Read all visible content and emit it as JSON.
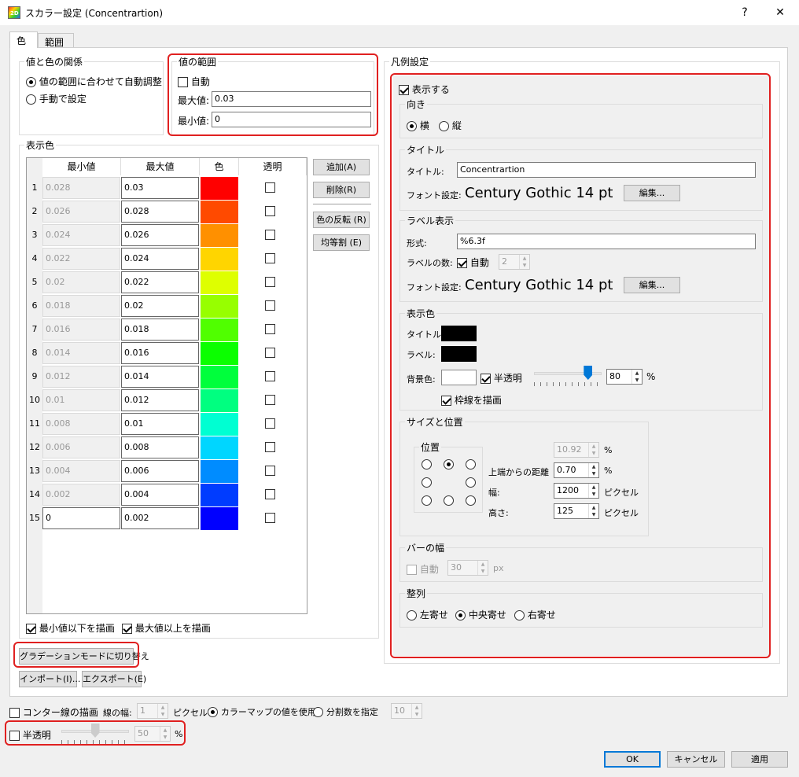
{
  "window": {
    "title": "スカラー設定 (Concentrartion)",
    "help": "?",
    "close": "✕",
    "app_icon": "app-2d-icon"
  },
  "tabs": [
    "色",
    "範囲"
  ],
  "relation": {
    "legend": "値と色の関係",
    "opt_auto": "値の範囲に合わせて自動調整",
    "opt_manual": "手動で設定"
  },
  "range": {
    "legend": "値の範囲",
    "auto_label": "自動",
    "max_label": "最大値:",
    "max_value": "0.03",
    "min_label": "最小値:",
    "min_value": "0"
  },
  "display_colors": {
    "legend": "表示色",
    "headers": [
      "最小値",
      "最大値",
      "色",
      "透明"
    ],
    "rows": [
      {
        "n": "1",
        "min": "0.028",
        "max": "0.03",
        "color": "#ff0000"
      },
      {
        "n": "2",
        "min": "0.026",
        "max": "0.028",
        "color": "#ff4a00"
      },
      {
        "n": "3",
        "min": "0.024",
        "max": "0.026",
        "color": "#ff9000"
      },
      {
        "n": "4",
        "min": "0.022",
        "max": "0.024",
        "color": "#ffd500"
      },
      {
        "n": "5",
        "min": "0.02",
        "max": "0.022",
        "color": "#deff00"
      },
      {
        "n": "6",
        "min": "0.018",
        "max": "0.02",
        "color": "#97ff00"
      },
      {
        "n": "7",
        "min": "0.016",
        "max": "0.018",
        "color": "#50ff00"
      },
      {
        "n": "8",
        "min": "0.014",
        "max": "0.016",
        "color": "#0bff00"
      },
      {
        "n": "9",
        "min": "0.012",
        "max": "0.014",
        "color": "#00ff3c"
      },
      {
        "n": "10",
        "min": "0.01",
        "max": "0.012",
        "color": "#00ff80"
      },
      {
        "n": "11",
        "min": "0.008",
        "max": "0.01",
        "color": "#00ffd2"
      },
      {
        "n": "12",
        "min": "0.006",
        "max": "0.008",
        "color": "#00d6ff"
      },
      {
        "n": "13",
        "min": "0.004",
        "max": "0.006",
        "color": "#008cff"
      },
      {
        "n": "14",
        "min": "0.002",
        "max": "0.004",
        "color": "#003cff"
      },
      {
        "n": "15",
        "min": "0",
        "max": "0.002",
        "color": "#0000ff"
      }
    ],
    "buttons": {
      "add": "追加(A)",
      "delete": "削除(R)",
      "invert": "色の反転 (R)",
      "equal": "均等割 (E)"
    },
    "draw_below_min": "最小値以下を描画",
    "draw_above_max": "最大値以上を描画"
  },
  "gradient_button": "グラデーションモードに切り替え",
  "import_button": "インポート(I)...",
  "export_button": "エクスポート(E)",
  "legend_settings": {
    "legend": "凡例設定",
    "show": "表示する",
    "orientation": {
      "legend": "向き",
      "horizontal": "横",
      "vertical": "縦"
    },
    "title": {
      "legend": "タイトル",
      "title_label": "タイトル:",
      "title_value": "Concentrartion",
      "font_label": "フォント設定:",
      "font_value": "Century Gothic 14 pt",
      "edit": "編集..."
    },
    "label": {
      "legend": "ラベル表示",
      "format_label": "形式:",
      "format_value": "%6.3f",
      "count_label": "ラベルの数:",
      "count_auto": "自動",
      "count_value": "2",
      "font_label": "フォント設定:",
      "font_value": "Century Gothic 14 pt",
      "edit": "編集..."
    },
    "colors": {
      "legend": "表示色",
      "title_label": "タイトル:",
      "label_label": "ラベル:",
      "bg_label": "背景色:",
      "semi": "半透明",
      "semi_value": "80",
      "semi_level_percent": 80,
      "pct": "%",
      "border": "枠線を描画"
    },
    "size_pos": {
      "legend": "サイズと位置",
      "pos_legend": "位置",
      "v1": "10.92",
      "u1": "%",
      "top_label": "上端からの距離",
      "top_value": "0.70",
      "u2": "%",
      "width_label": "幅:",
      "width_value": "1200",
      "width_unit": "ピクセル",
      "height_label": "高さ:",
      "height_value": "125",
      "height_unit": "ピクセル"
    },
    "bar_width": {
      "legend": "バーの幅",
      "auto": "自動",
      "value": "30",
      "unit": "px"
    },
    "align": {
      "legend": "整列",
      "left": "左寄せ",
      "center": "中央寄せ",
      "right": "右寄せ"
    }
  },
  "bottom": {
    "contour": "コンター線の描画",
    "line_width_label": "線の幅:",
    "line_width_value": "1",
    "line_width_unit": "ピクセル",
    "use_colormap": "カラーマップの値を使用",
    "specify_div": "分割数を指定",
    "div_value": "10",
    "semi": "半透明",
    "semi_value": "50",
    "semi_level_percent": 50,
    "pct": "%"
  },
  "footer": {
    "ok": "OK",
    "cancel": "キャンセル",
    "apply": "適用"
  }
}
